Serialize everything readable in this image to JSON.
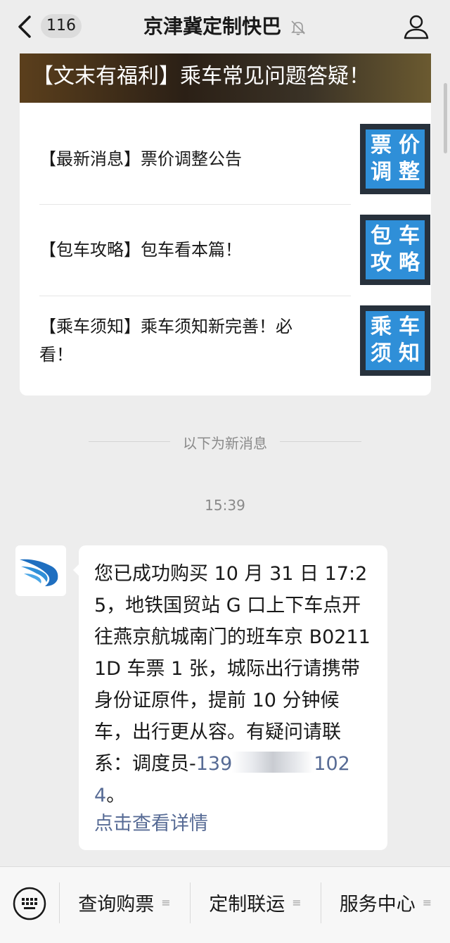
{
  "header": {
    "unread_count": "116",
    "title": "京津冀定制快巴"
  },
  "articles": {
    "banner_title": "【文末有福利】乘车常见问题答疑！",
    "items": [
      {
        "text": "【最新消息】票价调整公告",
        "thumb": [
          "票",
          "价",
          "调",
          "整"
        ]
      },
      {
        "text": "【包车攻略】包车看本篇！",
        "thumb": [
          "包",
          "车",
          "攻",
          "略"
        ]
      },
      {
        "text": "【乘车须知】乘车须知新完善！必看！",
        "thumb": [
          "乘",
          "车",
          "须",
          "知"
        ]
      }
    ]
  },
  "system": {
    "new_messages_divider": "以下为新消息",
    "timestamp": "15:39"
  },
  "message": {
    "text": "您已成功购买 10 月 31 日 17:25，地铁国贸站 G 口上下车点开往燕京航城南门的班车京 B02111D 车票 1 张，城际出行请携带身份证原件，提前 10 分钟候车，出行更从容。有疑问请联系：调度员-",
    "phone_prefix": "139",
    "phone_suffix": "1024",
    "end": "。",
    "detail_link": "点击查看详情"
  },
  "menu": {
    "items": [
      "查询购票",
      "定制联运",
      "服务中心"
    ]
  },
  "icons": {
    "back": "chevron-left-icon",
    "mute": "bell-off-icon",
    "profile": "person-icon",
    "keyboard": "keyboard-icon",
    "avatar": "wing-logo-icon"
  },
  "colors": {
    "link": "#576b95",
    "background": "#ededed",
    "thumb_blue": "#2f8fd8"
  }
}
